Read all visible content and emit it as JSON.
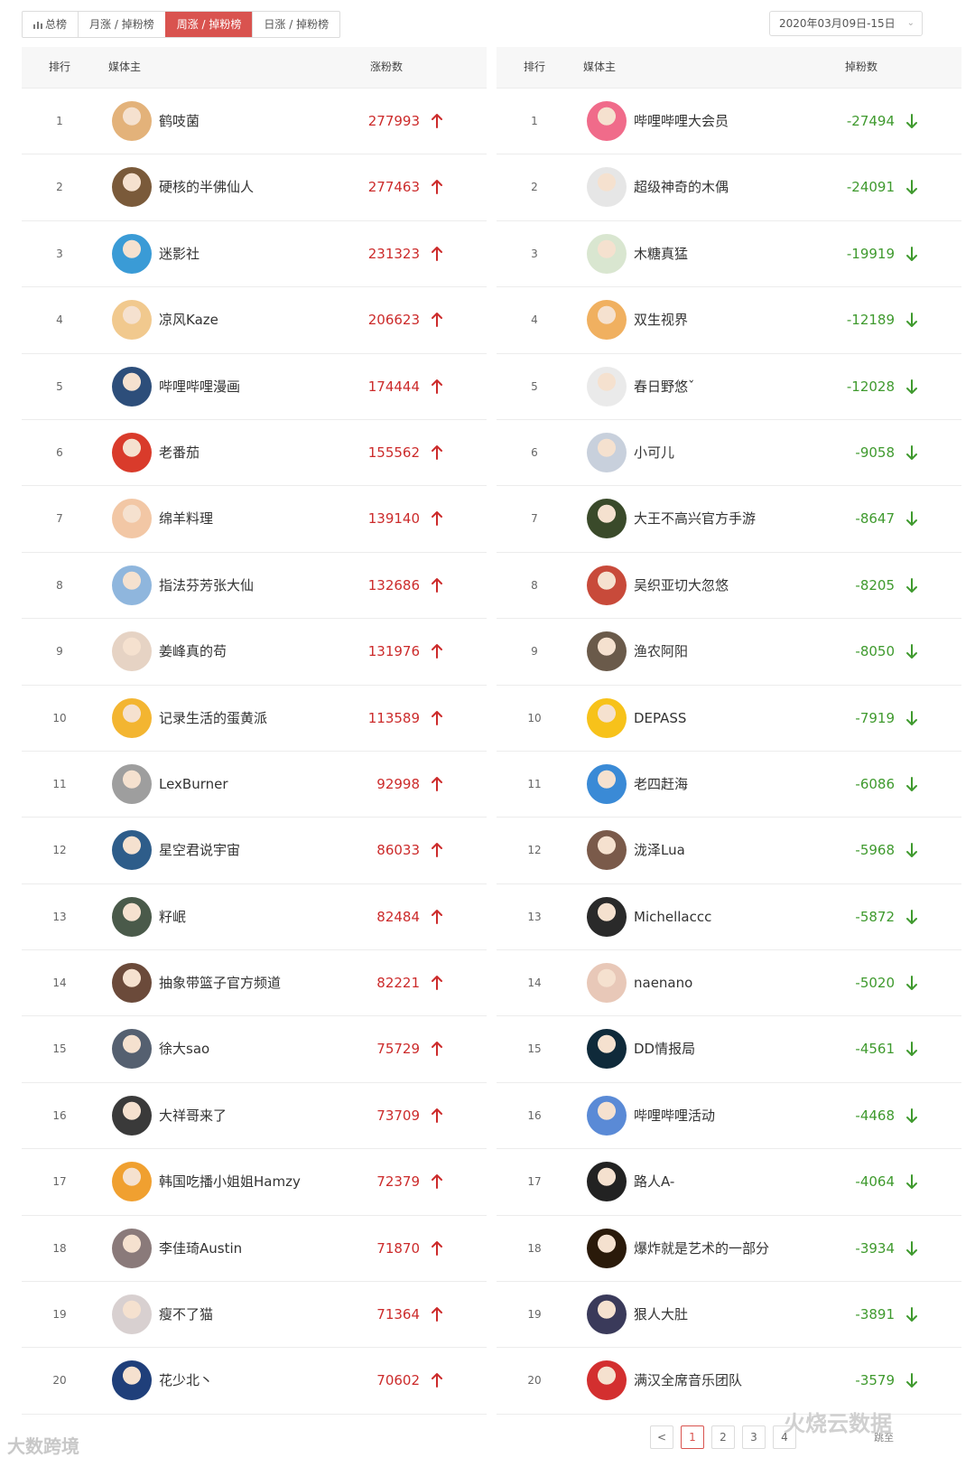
{
  "tabs": [
    {
      "label": "总榜",
      "active": false
    },
    {
      "label": "月涨 / 掉粉榜",
      "active": false
    },
    {
      "label": "周涨 / 掉粉榜",
      "active": true
    },
    {
      "label": "日涨 / 掉粉榜",
      "active": false
    }
  ],
  "date_range": "2020年03月09日-15日",
  "colors": {
    "accent": "#d9534f",
    "gain": "#cc2b2b",
    "loss": "#3f9a2e"
  },
  "gain_table": {
    "headers": {
      "rank": "排行",
      "name": "媒体主",
      "count": "涨粉数"
    },
    "rows": [
      {
        "rank": "1",
        "name": "鹤吱菌",
        "count": "277993"
      },
      {
        "rank": "2",
        "name": "硬核的半佛仙人",
        "count": "277463"
      },
      {
        "rank": "3",
        "name": "迷影社",
        "count": "231323"
      },
      {
        "rank": "4",
        "name": "凉风Kaze",
        "count": "206623"
      },
      {
        "rank": "5",
        "name": "哔哩哔哩漫画",
        "count": "174444"
      },
      {
        "rank": "6",
        "name": "老番茄",
        "count": "155562"
      },
      {
        "rank": "7",
        "name": "绵羊料理",
        "count": "139140"
      },
      {
        "rank": "8",
        "name": "指法芬芳张大仙",
        "count": "132686"
      },
      {
        "rank": "9",
        "name": "姜峰真的苟",
        "count": "131976"
      },
      {
        "rank": "10",
        "name": "记录生活的蛋黄派",
        "count": "113589"
      },
      {
        "rank": "11",
        "name": "LexBurner",
        "count": "92998"
      },
      {
        "rank": "12",
        "name": "星空君说宇宙",
        "count": "86033"
      },
      {
        "rank": "13",
        "name": "籽岷",
        "count": "82484"
      },
      {
        "rank": "14",
        "name": "抽象带篮子官方频道",
        "count": "82221"
      },
      {
        "rank": "15",
        "name": "徐大sao",
        "count": "75729"
      },
      {
        "rank": "16",
        "name": "大祥哥来了",
        "count": "73709"
      },
      {
        "rank": "17",
        "name": "韩国吃播小姐姐Hamzy",
        "count": "72379"
      },
      {
        "rank": "18",
        "name": "李佳琦Austin",
        "count": "71870"
      },
      {
        "rank": "19",
        "name": "瘦不了猫",
        "count": "71364"
      },
      {
        "rank": "20",
        "name": "花少北丶",
        "count": "70602"
      }
    ]
  },
  "loss_table": {
    "headers": {
      "rank": "排行",
      "name": "媒体主",
      "count": "掉粉数"
    },
    "rows": [
      {
        "rank": "1",
        "name": "哔哩哔哩大会员",
        "count": "-27494"
      },
      {
        "rank": "2",
        "name": "超级神奇的木偶",
        "count": "-24091"
      },
      {
        "rank": "3",
        "name": "木糖真猛",
        "count": "-19919"
      },
      {
        "rank": "4",
        "name": "双生视界",
        "count": "-12189"
      },
      {
        "rank": "5",
        "name": "春日野悠ˇ",
        "count": "-12028"
      },
      {
        "rank": "6",
        "name": "小可儿",
        "count": "-9058"
      },
      {
        "rank": "7",
        "name": "大王不高兴官方手游",
        "count": "-8647"
      },
      {
        "rank": "8",
        "name": "吴织亚切大忽悠",
        "count": "-8205"
      },
      {
        "rank": "9",
        "name": "渔农阿阳",
        "count": "-8050"
      },
      {
        "rank": "10",
        "name": "DEPASS",
        "count": "-7919"
      },
      {
        "rank": "11",
        "name": "老四赶海",
        "count": "-6086"
      },
      {
        "rank": "12",
        "name": "泷泽Lua",
        "count": "-5968"
      },
      {
        "rank": "13",
        "name": "Michellaccc",
        "count": "-5872"
      },
      {
        "rank": "14",
        "name": "naenano",
        "count": "-5020"
      },
      {
        "rank": "15",
        "name": "DD情报局",
        "count": "-4561"
      },
      {
        "rank": "16",
        "name": "哔哩哔哩活动",
        "count": "-4468"
      },
      {
        "rank": "17",
        "name": "路人A-",
        "count": "-4064"
      },
      {
        "rank": "18",
        "name": "爆炸就是艺术的一部分",
        "count": "-3934"
      },
      {
        "rank": "19",
        "name": "狠人大肚",
        "count": "-3891"
      },
      {
        "rank": "20",
        "name": "满汉全席音乐团队",
        "count": "-3579"
      }
    ]
  },
  "pagination": {
    "pages": [
      "<",
      "1",
      "2",
      "3",
      "4"
    ],
    "current": "1",
    "goto_label": "跳至"
  },
  "watermarks": {
    "left": "大数跨境",
    "right": "火烧云数据"
  }
}
